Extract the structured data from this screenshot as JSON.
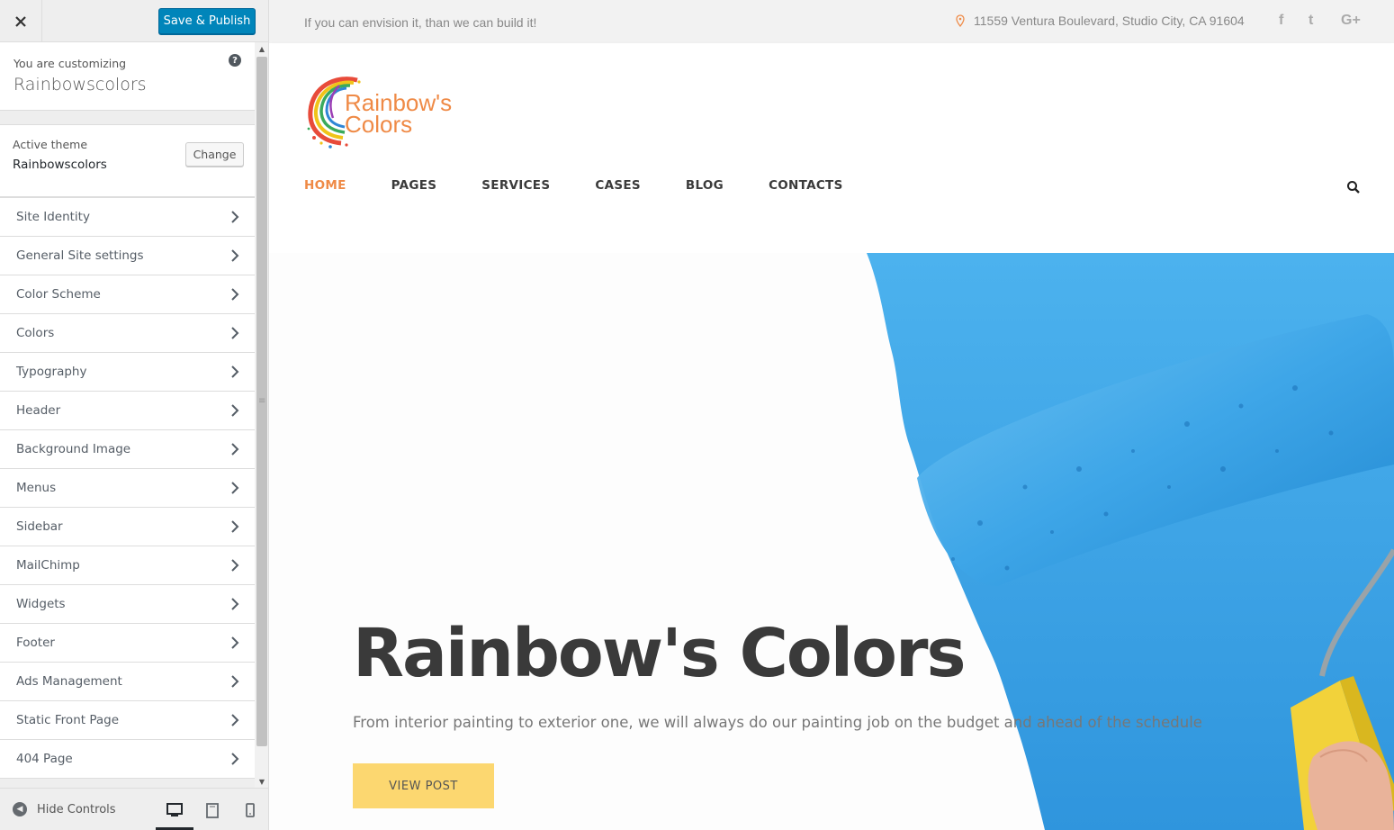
{
  "customizer": {
    "save_label": "Save & Publish",
    "customizing_pre": "You are customizing",
    "site_name": "Rainbowscolors",
    "active_theme_pre": "Active theme",
    "active_theme_name": "Rainbowscolors",
    "change_label": "Change",
    "panels": [
      {
        "label": "Site Identity"
      },
      {
        "label": "General Site settings"
      },
      {
        "label": "Color Scheme"
      },
      {
        "label": "Colors"
      },
      {
        "label": "Typography"
      },
      {
        "label": "Header"
      },
      {
        "label": "Background Image"
      },
      {
        "label": "Menus"
      },
      {
        "label": "Sidebar"
      },
      {
        "label": "MailChimp"
      },
      {
        "label": "Widgets"
      },
      {
        "label": "Footer"
      },
      {
        "label": "Ads Management"
      },
      {
        "label": "Static Front Page"
      },
      {
        "label": "404 Page"
      }
    ],
    "hide_controls_label": "Hide Controls",
    "devices": [
      "desktop-icon",
      "tablet-icon",
      "mobile-icon"
    ],
    "active_device": "desktop",
    "accent_color": "#0085ba"
  },
  "site": {
    "tagline": "If you can envision it, than we can build it!",
    "address": "11559 Ventura Boulevard, Studio City, CA 91604",
    "social": [
      "f",
      "t",
      "G+"
    ],
    "logo_line1": "Rainbow's",
    "logo_line2": "Colors",
    "nav": [
      {
        "label": "HOME",
        "active": true
      },
      {
        "label": "PAGES"
      },
      {
        "label": "SERVICES"
      },
      {
        "label": "CASES"
      },
      {
        "label": "BLOG"
      },
      {
        "label": "CONTACTS"
      }
    ],
    "brand_color": "#ef8a46",
    "hero": {
      "title": "Rainbow's Colors",
      "subtitle": "From interior painting to exterior one, we will always do our painting job on the budget and ahead of the schedule",
      "button_label": "VIEW POST",
      "button_color": "#fcd770",
      "paint_color": "#3ea6e8"
    }
  }
}
